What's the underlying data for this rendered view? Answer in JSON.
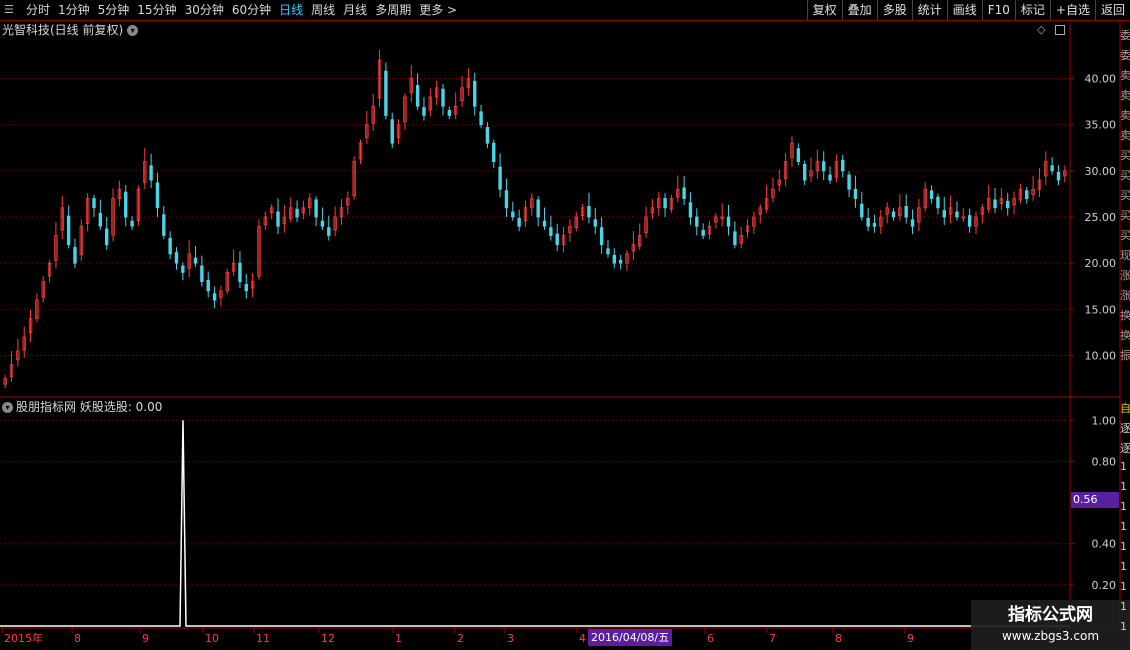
{
  "toolbar": {
    "left_items": [
      "分时",
      "1分钟",
      "5分钟",
      "15分钟",
      "30分钟",
      "60分钟",
      "日线",
      "周线",
      "月线",
      "多周期",
      "更多 >"
    ],
    "active_index": 6,
    "right_items": [
      "复权",
      "叠加",
      "多股",
      "统计",
      "画线",
      "F10",
      "标记",
      "+自选",
      "返回"
    ]
  },
  "chart": {
    "title": "光智科技(日线 前复权)",
    "indicator_title": "股朋指标网 妖股选股: 0.00",
    "price_ticks": [
      "40.00",
      "35.00",
      "30.00",
      "25.00",
      "20.00",
      "15.00",
      "10.00"
    ],
    "indicator_ticks": [
      "1.00",
      "0.80",
      "0.40",
      "0.20"
    ],
    "indicator_value_tag": "0.56",
    "date_tag": "2016/04/08/五",
    "x_labels": [
      "2015年",
      "8",
      "9",
      "10",
      "11",
      "12",
      "1",
      "2",
      "3",
      "4",
      "6",
      "7",
      "8",
      "9"
    ],
    "right_panel_top": [
      "委",
      "委",
      "卖",
      "卖",
      "卖",
      "卖",
      "买",
      "买",
      "买",
      "买",
      "买",
      "现",
      "涨",
      "涨",
      "换",
      "换",
      "振"
    ],
    "right_panel_bottom": [
      "自",
      "逐",
      "逐",
      "1",
      "1",
      "1",
      "1",
      "1",
      "1",
      "1",
      "1",
      "1"
    ]
  },
  "colors": {
    "up": "#ff3c3c",
    "down": "#4ad4e6",
    "grid": "#7a0000",
    "axis": "#a00000",
    "highlight": "#5a1fa0"
  },
  "chart_data": {
    "type": "candlestick",
    "price_range": [
      5.5,
      44.5
    ],
    "indicator_range": [
      0,
      1.05
    ],
    "indicator_peak": 1.0,
    "closes": [
      7.5,
      9,
      10.5,
      12,
      14,
      16,
      18,
      20,
      23,
      26,
      22,
      20,
      24,
      27,
      26,
      24,
      22,
      27,
      28,
      25,
      24,
      28,
      31,
      29,
      26,
      23,
      21,
      20,
      19,
      21,
      20,
      18,
      17,
      16,
      17,
      19,
      20,
      18,
      17,
      18,
      24,
      25,
      26,
      24,
      25,
      26,
      25,
      26,
      27,
      25,
      24,
      23,
      25,
      26,
      27,
      31,
      33,
      35,
      37,
      42,
      36,
      33,
      35,
      38,
      40,
      37,
      36,
      38,
      39,
      37,
      36,
      37,
      39,
      40,
      37,
      35,
      33,
      31,
      28,
      26,
      25,
      24,
      26,
      27,
      25,
      24,
      23,
      22,
      23,
      24,
      25,
      26,
      25,
      24,
      22,
      21,
      20,
      20,
      21,
      22,
      23,
      25,
      26,
      27,
      26,
      27,
      28,
      27,
      25,
      24,
      23,
      24,
      25,
      25,
      24,
      22,
      23,
      24,
      25,
      26,
      27,
      28,
      29,
      31,
      33,
      31,
      29,
      30,
      31,
      30,
      29,
      31,
      30,
      28,
      27,
      25,
      24,
      24,
      25,
      26,
      25,
      26,
      25,
      24,
      26,
      28,
      27,
      26,
      25,
      26,
      25,
      25,
      24,
      25,
      26,
      27,
      26,
      27,
      26,
      27,
      28,
      27,
      28,
      29,
      31,
      30,
      29,
      30
    ]
  }
}
